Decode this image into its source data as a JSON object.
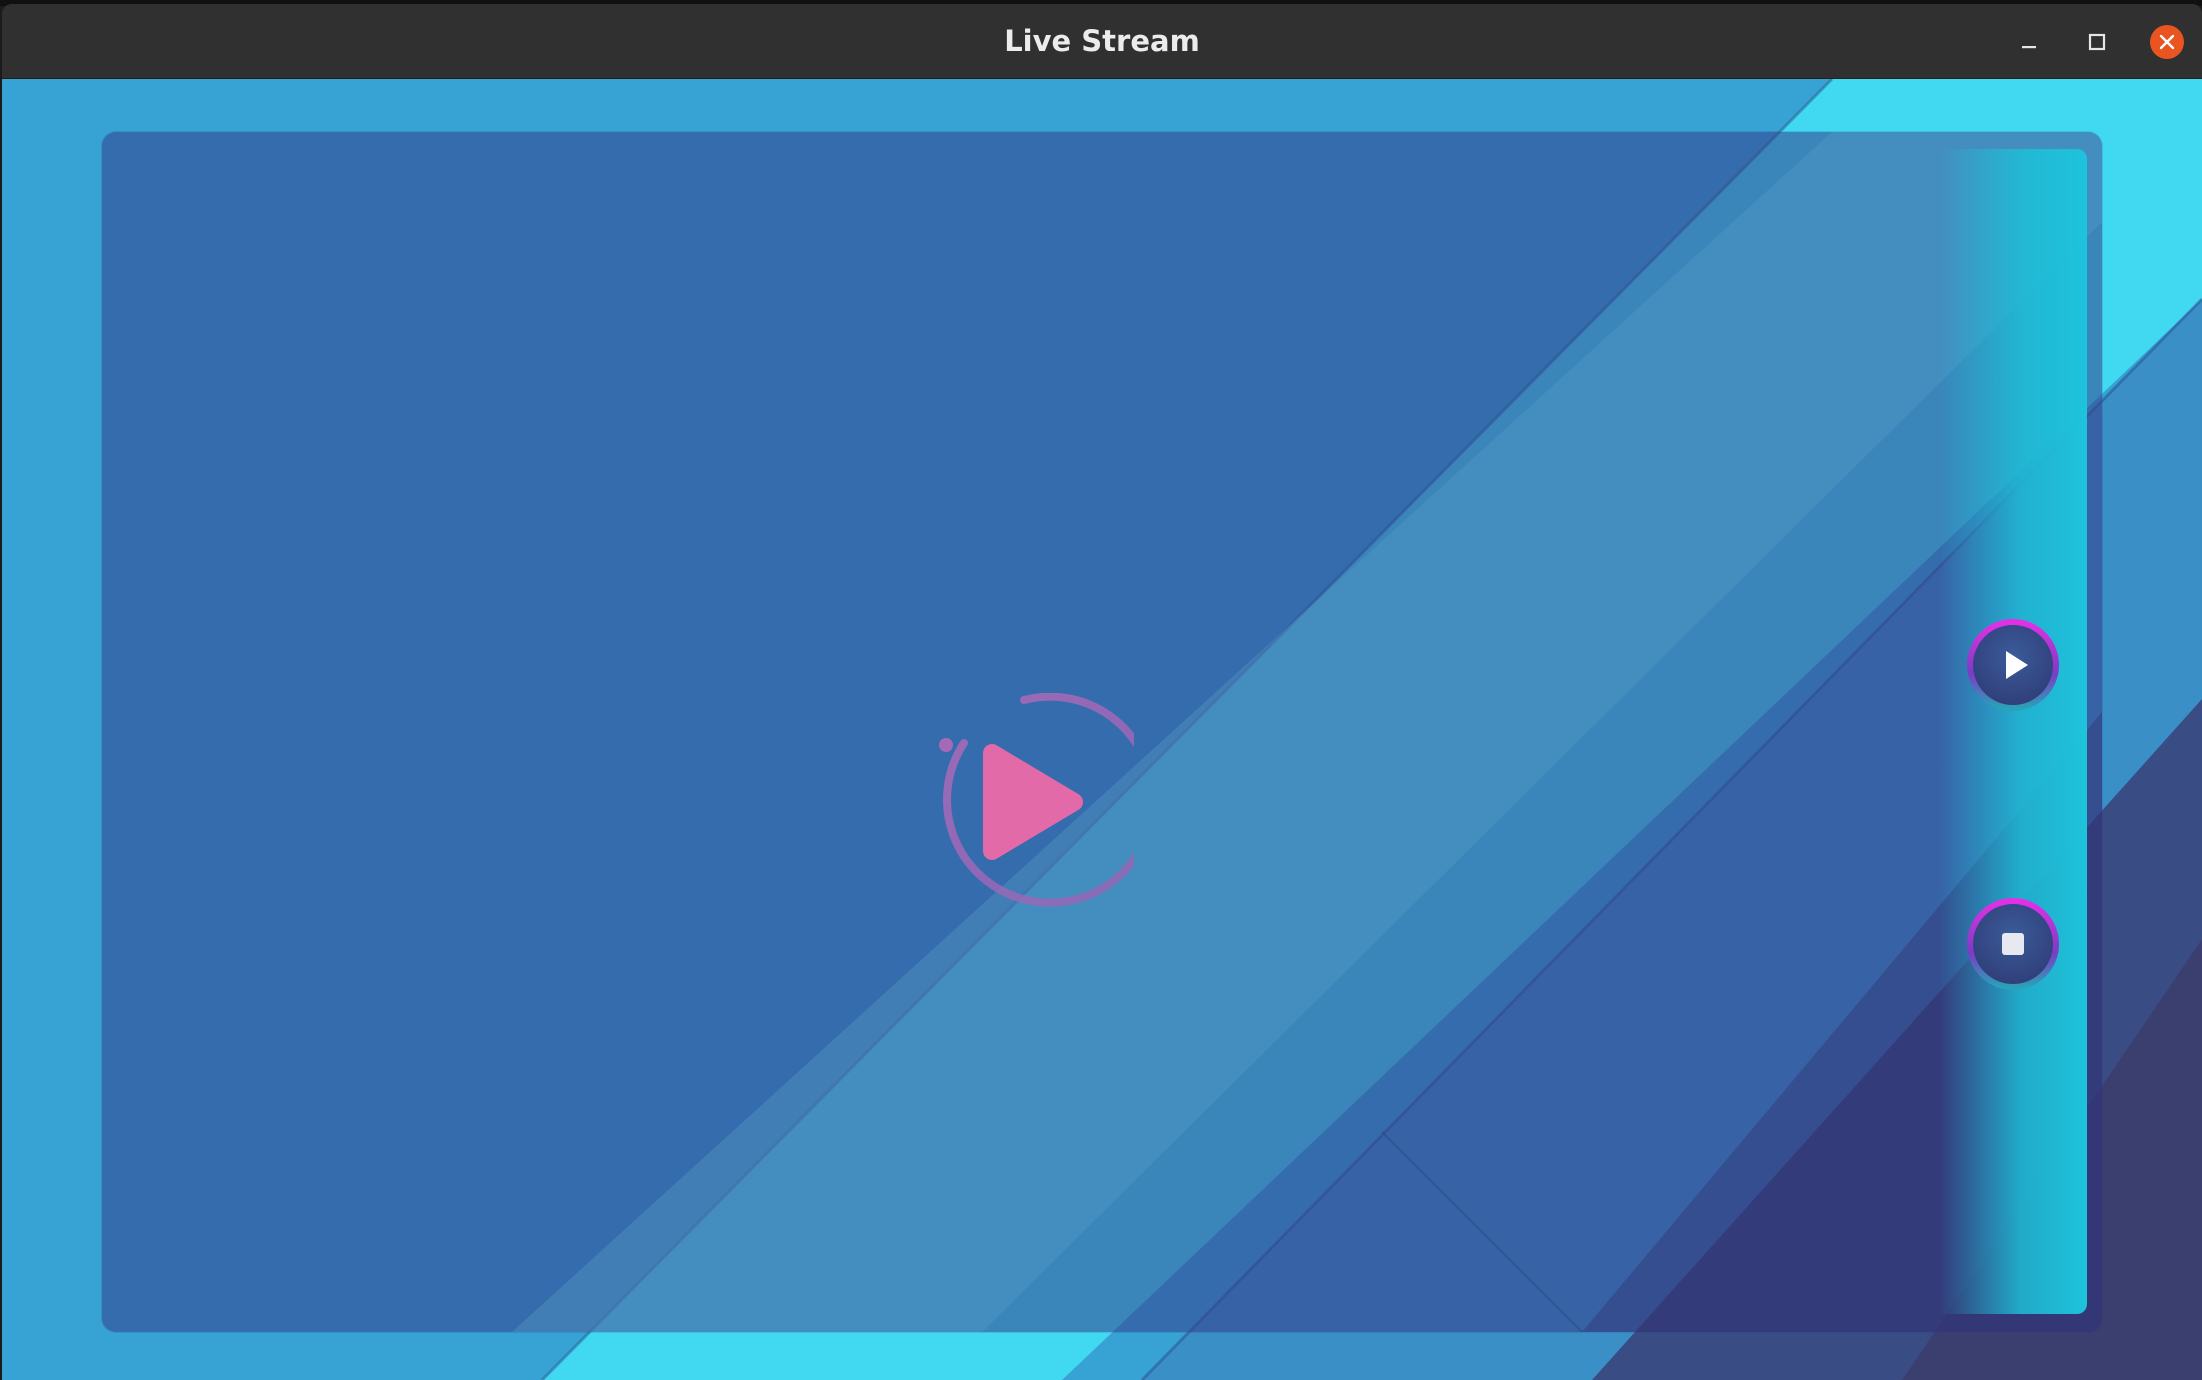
{
  "window": {
    "title": "Live Stream",
    "controls": {
      "minimize_icon": "minimize-icon",
      "maximize_icon": "maximize-icon",
      "close_icon": "close-icon"
    }
  },
  "player": {
    "center_icon": "play-circle-icon",
    "controls": [
      {
        "name": "play",
        "icon": "play-icon"
      },
      {
        "name": "stop",
        "icon": "stop-icon"
      }
    ]
  },
  "colors": {
    "titlebar": "#303030",
    "close_button": "#e95420",
    "background_light": "#3aa6d6",
    "background_cyan": "#40dcf3",
    "frame": "#37598e",
    "accent_pink": "#e36aa9",
    "accent_magenta": "#d42bd6"
  }
}
